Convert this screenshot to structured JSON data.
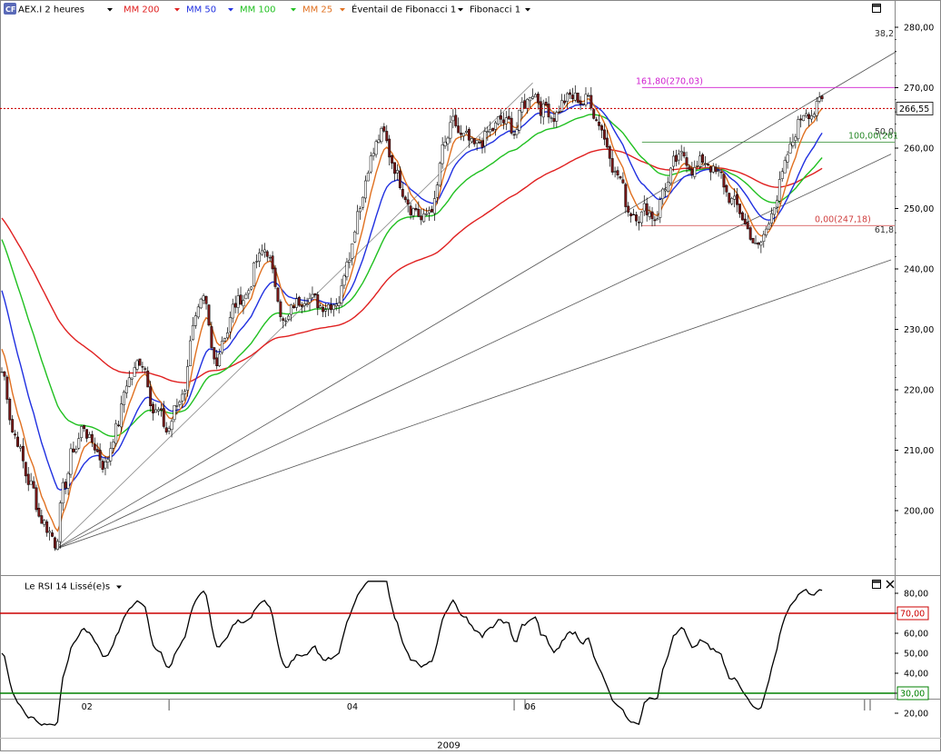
{
  "toolbar": {
    "instrument": "AEX.I 2 heures",
    "items": [
      {
        "label": "MM 200",
        "color": "#e02020"
      },
      {
        "label": "MM 50",
        "color": "#2030e0"
      },
      {
        "label": "MM 100",
        "color": "#20c020"
      },
      {
        "label": "MM 25",
        "color": "#e07020"
      },
      {
        "label": "Éventail de Fibonacci 1",
        "color": "#000000"
      },
      {
        "label": "Fibonacci 1",
        "color": "#000000"
      }
    ]
  },
  "rsi_panel": {
    "title": "Le RSI 14 Lissé(e)s"
  },
  "colors": {
    "mm200": "#e02020",
    "mm50": "#2030e0",
    "mm100": "#20c020",
    "mm25": "#e07020",
    "fib_ext": "#d020d0",
    "fib_100": "#2a8a2a",
    "fib_0": "#d04040",
    "rsi_upper": "#cc0000",
    "rsi_lower": "#008000",
    "current_price": "#cc0000"
  },
  "chart_data": [
    {
      "type": "line",
      "title": "",
      "price_axis": {
        "min": 193,
        "max": 284,
        "ticks": [
          "280,00",
          "270,00",
          "260,00",
          "250,00",
          "240,00",
          "230,00",
          "220,00",
          "210,00",
          "200,00"
        ],
        "tick_values": [
          280,
          270,
          260,
          250,
          240,
          230,
          220,
          210,
          200
        ]
      },
      "x_axis": {
        "num_bars": 310,
        "month_labels": [
          {
            "label": "02",
            "bar": 30
          },
          {
            "label": "04",
            "bar": 130
          },
          {
            "label": "06",
            "bar": 197
          }
        ],
        "separators": [
          63,
          193,
          325
        ],
        "year_label": "2009"
      },
      "current_price": {
        "value": 266.55,
        "label": "266,55"
      },
      "fibonacci_fan": {
        "origin": {
          "bar": 20,
          "value": 193.6
        },
        "lines": [
          {
            "to_bar": 200,
            "to_value": 270.8
          },
          {
            "to_bar": 337,
            "to_value": 276.0,
            "label": "38,2"
          },
          {
            "to_bar": 335,
            "to_value": 259.0,
            "label": "50,0"
          },
          {
            "to_bar": 335,
            "to_value": 241.5,
            "label": "61,8"
          }
        ]
      },
      "fibonacci_retracement": [
        {
          "label": "161,80(270,03)",
          "value": 270.03,
          "from_bar": 248
        },
        {
          "label": "100,00(261",
          "value": 261.0,
          "from_bar": 248
        },
        {
          "label": "0,00(247,18)",
          "value": 247.18,
          "from_bar": 248
        }
      ],
      "price_series": {
        "name": "AEX.I",
        "anchors": [
          [
            0,
            223
          ],
          [
            5,
            213
          ],
          [
            10,
            205
          ],
          [
            15,
            199
          ],
          [
            18,
            197
          ],
          [
            20,
            195
          ],
          [
            23,
            203
          ],
          [
            27,
            210
          ],
          [
            31,
            214
          ],
          [
            34,
            211
          ],
          [
            39,
            208
          ],
          [
            43,
            214
          ],
          [
            48,
            222
          ],
          [
            53,
            225
          ],
          [
            58,
            217
          ],
          [
            62,
            213
          ],
          [
            66,
            217
          ],
          [
            69,
            221
          ],
          [
            72,
            232
          ],
          [
            76,
            233
          ],
          [
            80,
            224
          ],
          [
            84,
            230
          ],
          [
            88,
            234
          ],
          [
            92,
            236
          ],
          [
            96,
            241
          ],
          [
            100,
            243
          ],
          [
            103,
            237
          ],
          [
            107,
            231
          ],
          [
            111,
            234
          ],
          [
            115,
            237
          ],
          [
            119,
            234
          ],
          [
            123,
            235
          ],
          [
            127,
            236
          ],
          [
            131,
            244
          ],
          [
            135,
            252
          ],
          [
            139,
            259
          ],
          [
            143,
            262
          ],
          [
            147,
            258
          ],
          [
            151,
            254
          ],
          [
            155,
            251
          ],
          [
            159,
            248
          ],
          [
            163,
            251
          ],
          [
            166,
            259
          ],
          [
            170,
            263
          ],
          [
            174,
            261
          ],
          [
            178,
            259
          ],
          [
            183,
            262
          ],
          [
            188,
            264
          ],
          [
            193,
            263
          ],
          [
            197,
            267
          ],
          [
            200,
            270
          ],
          [
            204,
            267
          ],
          [
            208,
            266
          ],
          [
            212,
            268
          ],
          [
            217,
            268
          ],
          [
            221,
            268
          ],
          [
            225,
            265
          ],
          [
            228,
            261
          ],
          [
            232,
            256
          ],
          [
            236,
            250
          ],
          [
            240,
            250
          ],
          [
            243,
            250
          ],
          [
            246,
            249
          ],
          [
            250,
            254
          ],
          [
            254,
            257
          ],
          [
            258,
            258
          ],
          [
            262,
            257
          ],
          [
            266,
            258
          ],
          [
            270,
            255
          ],
          [
            274,
            252
          ],
          [
            278,
            249
          ],
          [
            282,
            246
          ],
          [
            285,
            243
          ],
          [
            288,
            246
          ],
          [
            291,
            252
          ],
          [
            294,
            255
          ],
          [
            297,
            259
          ],
          [
            300,
            264
          ],
          [
            303,
            267
          ],
          [
            306,
            267
          ]
        ]
      },
      "rsi_axis": {
        "min": 13,
        "max": 87,
        "ticks": [
          "80,00",
          "70,00",
          "60,00",
          "50,00",
          "40,00",
          "30,00",
          "20,00"
        ],
        "tick_values": [
          80,
          70,
          60,
          50,
          40,
          30,
          20
        ],
        "upper": {
          "value": 70,
          "label": "70,00"
        },
        "lower": {
          "value": 30,
          "label": "30,00"
        }
      },
      "legend": "none",
      "grid": false
    }
  ]
}
